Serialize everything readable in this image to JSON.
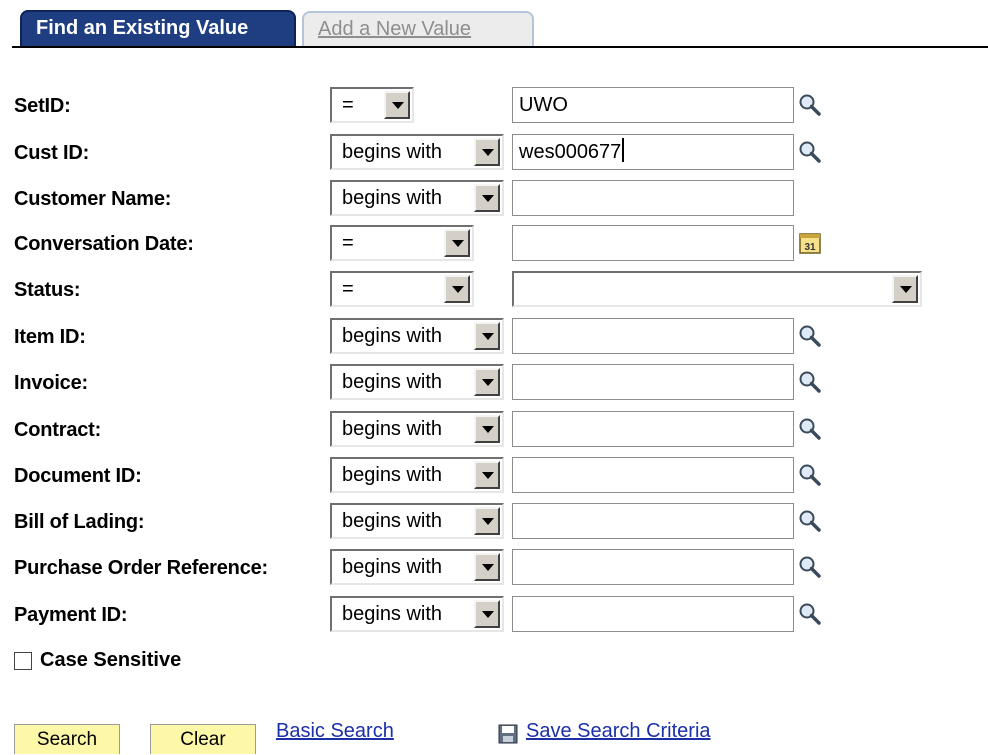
{
  "tabs": [
    {
      "label": "Find an Existing Value",
      "active": true
    },
    {
      "label": "Add a New Value",
      "active": false
    }
  ],
  "fields": [
    {
      "label": "SetID:",
      "operator": "=",
      "value": "UWO",
      "icon": "lookup-icon"
    },
    {
      "label": "Cust ID:",
      "operator": "begins with",
      "value": "wes000677",
      "icon": "lookup-icon"
    },
    {
      "label": "Customer Name:",
      "operator": "begins with",
      "value": "",
      "icon": ""
    },
    {
      "label": "Conversation Date:",
      "operator": "=",
      "value": "",
      "icon": "calendar-icon"
    },
    {
      "label": "Status:",
      "operator": "=",
      "value": "",
      "icon": ""
    },
    {
      "label": "Item ID:",
      "operator": "begins with",
      "value": "",
      "icon": "lookup-icon"
    },
    {
      "label": "Invoice:",
      "operator": "begins with",
      "value": "",
      "icon": "lookup-icon"
    },
    {
      "label": "Contract:",
      "operator": "begins with",
      "value": "",
      "icon": "lookup-icon"
    },
    {
      "label": "Document ID:",
      "operator": "begins with",
      "value": "",
      "icon": "lookup-icon"
    },
    {
      "label": "Bill of Lading:",
      "operator": "begins with",
      "value": "",
      "icon": "lookup-icon"
    },
    {
      "label": "Purchase Order Reference:",
      "operator": "begins with",
      "value": "",
      "icon": "lookup-icon"
    },
    {
      "label": "Payment ID:",
      "operator": "begins with",
      "value": "",
      "icon": "lookup-icon"
    }
  ],
  "case_sensitive": {
    "label": "Case Sensitive",
    "checked": false
  },
  "buttons": {
    "search": "Search",
    "clear": "Clear"
  },
  "links": {
    "basic_search": "Basic Search",
    "save_search": "Save Search Criteria"
  },
  "colors": {
    "active_tab": "#1f3e82",
    "button_bg": "#fdf7a8",
    "link": "#1b2fa8"
  }
}
